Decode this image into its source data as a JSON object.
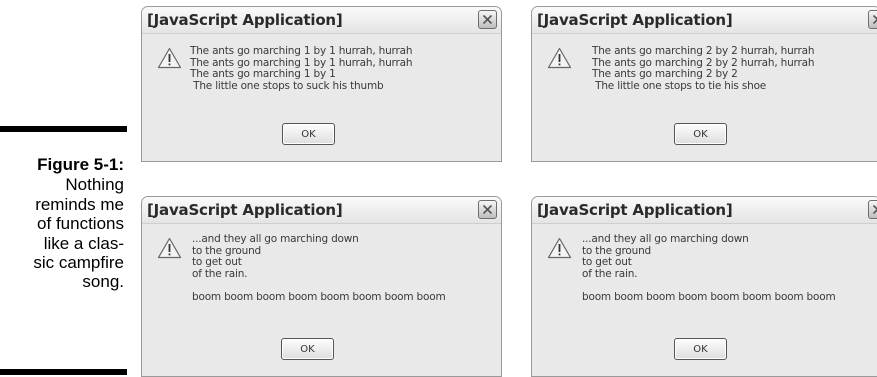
{
  "figure": {
    "label": "Figure 5-1:",
    "caption": "Nothing\nreminds me\nof functions\nlike a clas-\nsic campfire\nsong."
  },
  "dialogs": [
    {
      "title": "[JavaScript Application]",
      "message": "The ants go marching 1 by 1 hurrah, hurrah\nThe ants go marching 1 by 1 hurrah, hurrah\nThe ants go marching 1 by 1\n The little one stops to suck his thumb",
      "ok_label": "OK",
      "icon": "warning-icon",
      "close_icon": "close-icon"
    },
    {
      "title": "[JavaScript Application]",
      "message": "The ants go marching 2 by 2 hurrah, hurrah\nThe ants go marching 2 by 2 hurrah, hurrah\nThe ants go marching 2 by 2\n The little one stops to tie his shoe",
      "ok_label": "OK",
      "icon": "warning-icon",
      "close_icon": "close-icon"
    },
    {
      "title": "[JavaScript Application]",
      "message": "...and they all go marching down\nto the ground\nto get out\nof the rain.\n\nboom boom boom boom boom boom boom boom",
      "ok_label": "OK",
      "icon": "warning-icon",
      "close_icon": "close-icon"
    },
    {
      "title": "[JavaScript Application]",
      "message": "...and they all go marching down\nto the ground\nto get out\nof the rain.\n\nboom boom boom boom boom boom boom boom",
      "ok_label": "OK",
      "icon": "warning-icon",
      "close_icon": "close-icon"
    }
  ]
}
